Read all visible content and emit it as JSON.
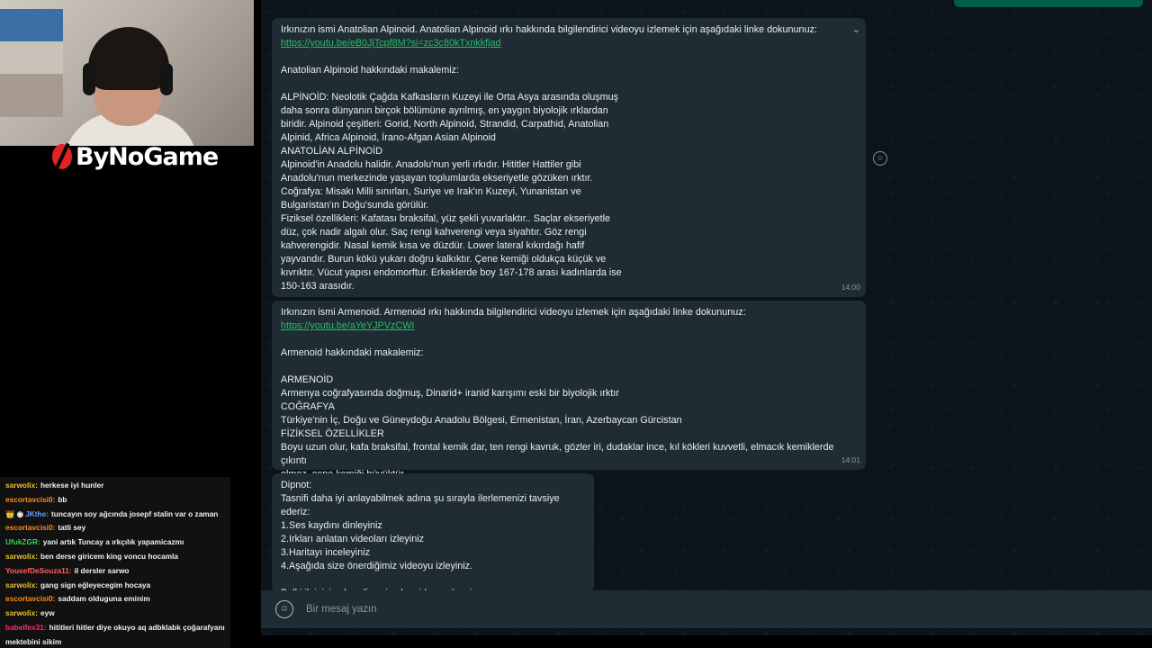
{
  "stream": {
    "brand": "ByNoGame"
  },
  "chat": [
    {
      "user": "sarwolix:",
      "msg": "herkese iyi hunler",
      "color": "#e6c229"
    },
    {
      "user": "escortavcisi0:",
      "msg": "bb",
      "color": "#ff8c1a"
    },
    {
      "user": "JKthe:",
      "msg": "tuncayın soy ağcında josepf stalin var o zaman",
      "color": "#5e9cff",
      "badge": "👑 ◉"
    },
    {
      "user": "escortavcisi0:",
      "msg": "tatli sey",
      "color": "#ff8c1a"
    },
    {
      "user": "UfukZGR:",
      "msg": "yani artık Tuncay a ırkçılık yapamicazmı",
      "color": "#39d353"
    },
    {
      "user": "sarwolix:",
      "msg": "ben derse giricem king voncu hocamla",
      "color": "#e6c229"
    },
    {
      "user": "YousefDeSouza11:",
      "msg": "il dersler sarwo",
      "color": "#ff5f5f"
    },
    {
      "user": "sarwolix:",
      "msg": "gang sign eğleyecegim hocaya",
      "color": "#e6c229"
    },
    {
      "user": "escortavcisi0:",
      "msg": "saddam olduguna eminim",
      "color": "#ff8c1a"
    },
    {
      "user": "sarwolix:",
      "msg": "eyw",
      "color": "#e6c229"
    },
    {
      "user": "babelfex31:",
      "msg": "hititleri hitler diye okuyo aq adbklabk çoğarafyanı",
      "color": "#ff2e63"
    },
    {
      "user": "",
      "msg": "mektebini sikim",
      "color": "#ffffff"
    }
  ],
  "messages": {
    "m1": {
      "intro": "Irkınızın ismi Anatolian Alpinoid. Anatolian Alpinoid ırkı hakkında bilgilendirici videoyu izlemek için aşağıdaki linke dokununuz:",
      "link": "https://youtu.be/eB0JjTcpf8M?si=zc3c80kTxnkkfjad",
      "heading": "Anatolian Alpinoid hakkındaki makalemiz:",
      "body": "ALPİNOİD: Neolotik Çağda Kafkasların Kuzeyi ile Orta Asya arasında oluşmuş\ndaha sonra dünyanın birçok bölümüne ayrılmış, en yaygın biyolojik ırklardan\nbiridir. Alpinoid çeşitleri: Gorid, North Alpinoid, Strandid, Carpathid, Anatolian\nAlpinid, Africa Alpinoid, İrano-Afgan Asian Alpinoid\nANATOLİAN ALPİNOİD\nAlpinoid'in Anadolu halidir. Anadolu'nun yerli ırkıdır. Hititler Hattiler gibi\nAnadolu'nun merkezinde yaşayan toplumlarda ekseriyetle gözüken ırktır.\nCoğrafya: Misakı Milli sınırları, Suriye ve Irak'ın Kuzeyi, Yunanistan ve\nBulgaristan'ın Doğu'sunda görülür.\nFiziksel özellikleri: Kafatası braksifal, yüz şekli yuvarlaktır.. Saçlar ekseriyetle\ndüz, çok nadir algalı olur. Saç rengi kahverengi veya siyahtır. Göz rengi\nkahverengidir. Nasal kemik kısa ve düzdür. Lower lateral kıkırdağı hafif\nyayvandır. Burun kökü yukarı doğru kalkıktır. Çene kemiği oldukça küçük ve\nkıvrıktır. Vücut yapısı endomorftur. Erkeklerde boy 167-178 arası kadınlarda ise\n150-163 arasıdır.",
      "time": "14:00"
    },
    "m2": {
      "intro": "Irkınızın ismi Armenoid. Armenoid ırkı hakkında bilgilendirici videoyu izlemek için aşağıdaki linke dokununuz:",
      "link": "https://youtu.be/aYeYJPVzCWI",
      "heading": "Armenoid hakkındaki makalemiz:",
      "body": "ARMENOİD\nArmenya coğrafyasında doğmuş, Dinarid+ iranid karışımı eski bir biyolojik ırktır\nCOĞRAFYA\nTürkiye'nin İç, Doğu ve Güneydoğu Anadolu Bölgesi, Ermenistan, İran, Azerbaycan Gürcistan\nFİZİKSEL ÖZELLİKLER\nBoyu uzun olur, kafa braksifal, frontal kemik dar, ten rengi kavruk, gözler iri, dudaklar ince, kıl kökleri kuvvetli, elmacık kemiklerde çıkıntı\nolmaz, çene kemiği büyüktür.",
      "time": "14:01"
    },
    "m3": {
      "body": "Dipnot:\nTasnifi daha iyi anlayabilmek adına şu sırayla ilerlemenizi tavsiye ederiz:\n1.Ses kaydını dinleyiniz\n2.Irkları anlatan videoları izleyiniz\n3.Haritayı inceleyiniz\n4.Aşağıda size önerdiğimiz videoyu izleyiniz.\n\nBelki ilginizi çeker diye size bu videoyu öneriyorum:"
    }
  },
  "composer": {
    "placeholder": "Bir mesaj yazın"
  }
}
